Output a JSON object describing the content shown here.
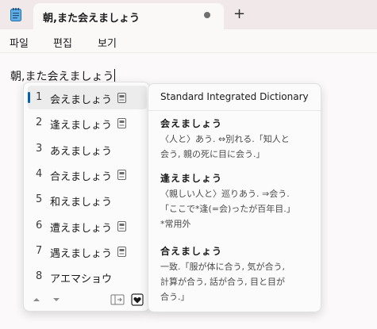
{
  "tab": {
    "title": "朝,また会えましょう"
  },
  "new_tab_label": "+",
  "menu": [
    "파일",
    "편집",
    "보기"
  ],
  "editor": {
    "committed": "朝,また",
    "composing": "会えましょう"
  },
  "candidates": [
    {
      "num": "1",
      "text": "会えましょう",
      "dict": true,
      "selected": true
    },
    {
      "num": "2",
      "text": "逢えましょう",
      "dict": true,
      "selected": false
    },
    {
      "num": "3",
      "text": "あえましょう",
      "dict": false,
      "selected": false
    },
    {
      "num": "4",
      "text": "合えましょう",
      "dict": true,
      "selected": false
    },
    {
      "num": "5",
      "text": "和えましょう",
      "dict": false,
      "selected": false
    },
    {
      "num": "6",
      "text": "遭えましょう",
      "dict": true,
      "selected": false
    },
    {
      "num": "7",
      "text": "遇えましょう",
      "dict": true,
      "selected": false
    },
    {
      "num": "8",
      "text": "アエマショウ",
      "dict": false,
      "selected": false
    }
  ],
  "dictionary": {
    "title": "Standard Integrated Dictionary",
    "entries": [
      {
        "head": "会えましょう",
        "lines": [
          "〈人と〉あう. ⇔別れる.「知人と",
          "会う, 親の死に目に会う.」"
        ]
      },
      {
        "head": "逢えましょう",
        "lines": [
          "〈親しい人と〉巡りあう. ⇒会う.",
          "「ここで*逢(=会)ったが百年目.」",
          "*常用外"
        ]
      },
      {
        "head": "合えましょう",
        "lines": [
          "一致.「服が体に合う, 気が合う,",
          "計算が合う, 話が合う, 目と目が",
          "合う.」"
        ]
      }
    ]
  },
  "accent_color": "#005fb8",
  "icons": [
    "notepad-icon",
    "dictionary-icon",
    "arrow-up-icon",
    "arrow-down-icon",
    "expand-panel-icon",
    "favorite-icon"
  ]
}
